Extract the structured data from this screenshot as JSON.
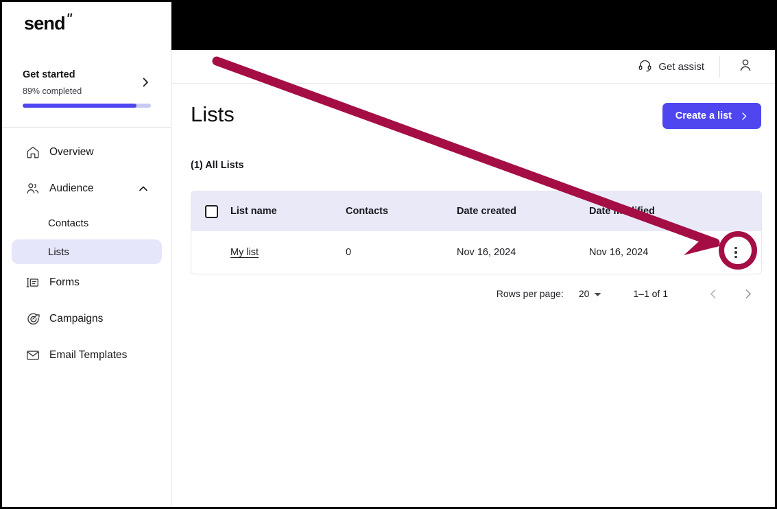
{
  "brand": {
    "logo_text": "send",
    "accent_color": "#4f46f0",
    "annotation_color": "#a50d45"
  },
  "sidebar": {
    "get_started": {
      "title": "Get started",
      "subtitle": "89% completed",
      "progress_percent": 89,
      "chevron_icon": "chevron-right-icon"
    },
    "items": [
      {
        "label": "Overview",
        "icon": "home-icon",
        "type": "item",
        "active": false
      },
      {
        "label": "Audience",
        "icon": "users-icon",
        "type": "group",
        "active": false,
        "expanded": true,
        "chevron_icon": "chevron-up-icon"
      },
      {
        "label": "Contacts",
        "icon": "",
        "type": "sub",
        "active": false
      },
      {
        "label": "Lists",
        "icon": "",
        "type": "sub",
        "active": true
      },
      {
        "label": "Forms",
        "icon": "forms-icon",
        "type": "item",
        "active": false
      },
      {
        "label": "Campaigns",
        "icon": "target-icon",
        "type": "item",
        "active": false
      },
      {
        "label": "Email Templates",
        "icon": "envelope-icon",
        "type": "item",
        "active": false
      }
    ]
  },
  "topbar": {
    "get_assist_label": "Get assist",
    "get_assist_icon": "headset-icon",
    "account_icon": "person-icon"
  },
  "main": {
    "page_title": "Lists",
    "create_button": {
      "label": "Create a list",
      "chevron": "›"
    },
    "list_count_label": "(1) All Lists",
    "table": {
      "columns": [
        "List name",
        "Contacts",
        "Date created",
        "Date modified"
      ],
      "select_all_checkbox": "unchecked",
      "rows": [
        {
          "name": "My list",
          "contacts": "0",
          "date_created": "Nov 16, 2024",
          "date_modified": "Nov 16, 2024",
          "actions_icon": "kebab-menu-icon"
        }
      ]
    },
    "pagination": {
      "rows_per_page_label": "Rows per page:",
      "rows_per_page_value": "20",
      "dropdown_icon": "caret-down-icon",
      "range_label": "1–1 of 1",
      "prev_icon": "chevron-left-icon",
      "next_icon": "chevron-right-icon"
    }
  },
  "annotation": {
    "type": "arrow-and-circle",
    "target": "kebab-menu-icon",
    "color": "#a50d45"
  }
}
